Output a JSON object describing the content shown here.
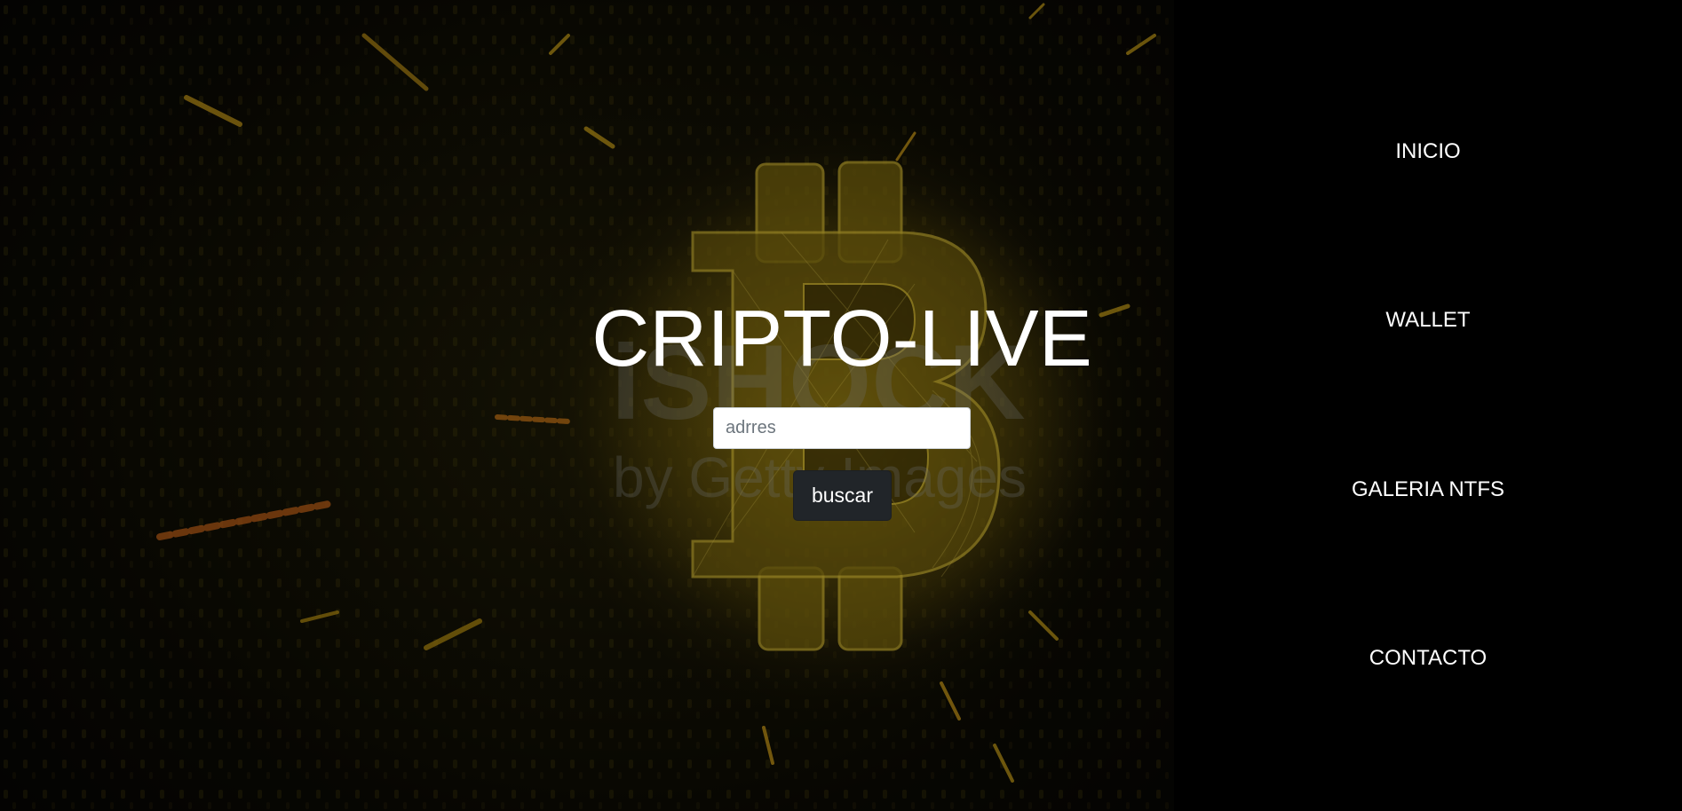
{
  "hero": {
    "title": "CRIPTO-LIVE",
    "search": {
      "placeholder": "adrres",
      "value": ""
    },
    "search_button_label": "buscar"
  },
  "sidebar": {
    "items": [
      {
        "label": "INICIO"
      },
      {
        "label": "WALLET"
      },
      {
        "label": "GALERIA NTFS"
      },
      {
        "label": "CONTACTO"
      }
    ]
  },
  "colors": {
    "sidebar_bg": "#000000",
    "button_bg": "#212529",
    "title_text": "#ffffff",
    "bitcoin_gold": "#d9b21c"
  },
  "icons": {
    "background": "bitcoin-logo-icon"
  }
}
